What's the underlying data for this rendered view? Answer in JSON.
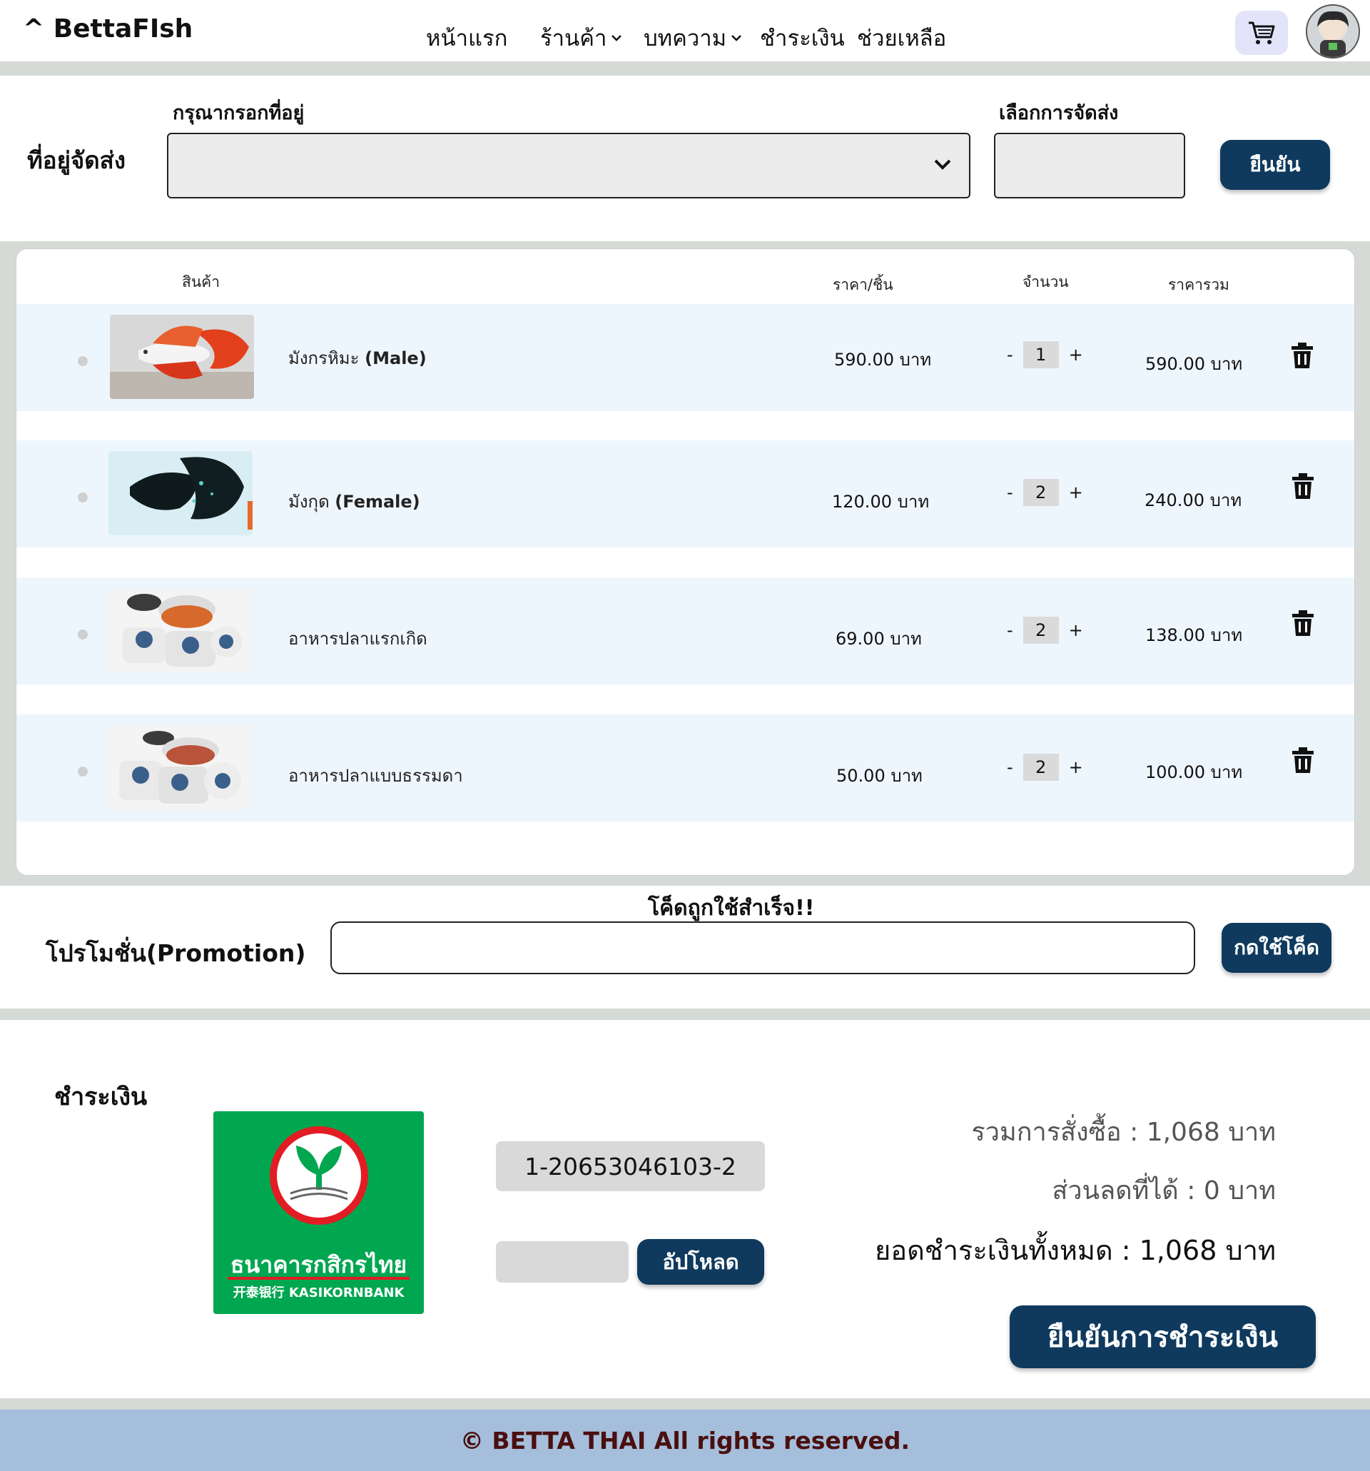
{
  "header": {
    "logo": "^ BettaFIsh",
    "nav": [
      {
        "label": "หน้าแรก"
      },
      {
        "label": "ร้านค้า",
        "dropdown": true
      },
      {
        "label": "บทความ",
        "dropdown": true
      },
      {
        "label": "ชำระเงิน"
      },
      {
        "label": "ช่วยเหลือ"
      }
    ]
  },
  "address": {
    "section_label": "ที่อยู่จัดส่ง",
    "address_label": "กรุณากรอกที่อยู่",
    "address_value": "",
    "shipping_label": "เลือกการจัดส่ง",
    "shipping_value": "",
    "confirm_label": "ยืนยัน"
  },
  "cart": {
    "headers": {
      "product": "สินค้า",
      "unit_price": "ราคา/ชิ้น",
      "quantity": "จำนวน",
      "total": "ราคารวม"
    },
    "items": [
      {
        "name": "มังกรหิมะ",
        "tag": "(Male)",
        "price": "590.00 บาท",
        "qty": "1",
        "total": "590.00 บาท"
      },
      {
        "name": "มังกุด",
        "tag": "(Female)",
        "price": "120.00 บาท",
        "qty": "2",
        "total": "240.00 บาท"
      },
      {
        "name": "อาหารปลาแรกเกิด",
        "tag": "",
        "price": "69.00 บาท",
        "qty": "2",
        "total": "138.00 บาท"
      },
      {
        "name": "อาหารปลาแบบธรรมดา",
        "tag": "",
        "price": "50.00 บาท",
        "qty": "2",
        "total": "100.00 บาท"
      }
    ],
    "minus": "-",
    "plus": "+"
  },
  "promo": {
    "label": "โปรโมชั่น(Promotion)",
    "status": "โค็ดถูกใช้สำเร็จ!!",
    "code_value": "",
    "apply_label": "กดใช้โค็ด"
  },
  "payment": {
    "title": "ชำระเงิน",
    "bank_name_th": "ธนาคารกสิกรไทย",
    "bank_name_en": "开泰银行 KASIKORNBANK",
    "account_number": "1-20653046103-2",
    "upload_label": "อัปโหลด",
    "order_total_label": "รวมการสั่งซื้อ :",
    "order_total_value": "1,068 บาท",
    "discount_label": "ส่วนลดที่ได้ :",
    "discount_value": "0 บาท",
    "grand_total_label": "ยอดชำระเงินทั้งหมด :",
    "grand_total_value": "1,068 บาท",
    "confirm_payment_label": "ยืนยันการชำระเงิน"
  },
  "footer": {
    "copyright": "© BETTA THAI All rights reserved."
  },
  "colors": {
    "accent": "#0f3a5e",
    "row_bg": "#eef6fd",
    "footer_bg": "#a5bedc",
    "kbank_green": "#00a650"
  }
}
